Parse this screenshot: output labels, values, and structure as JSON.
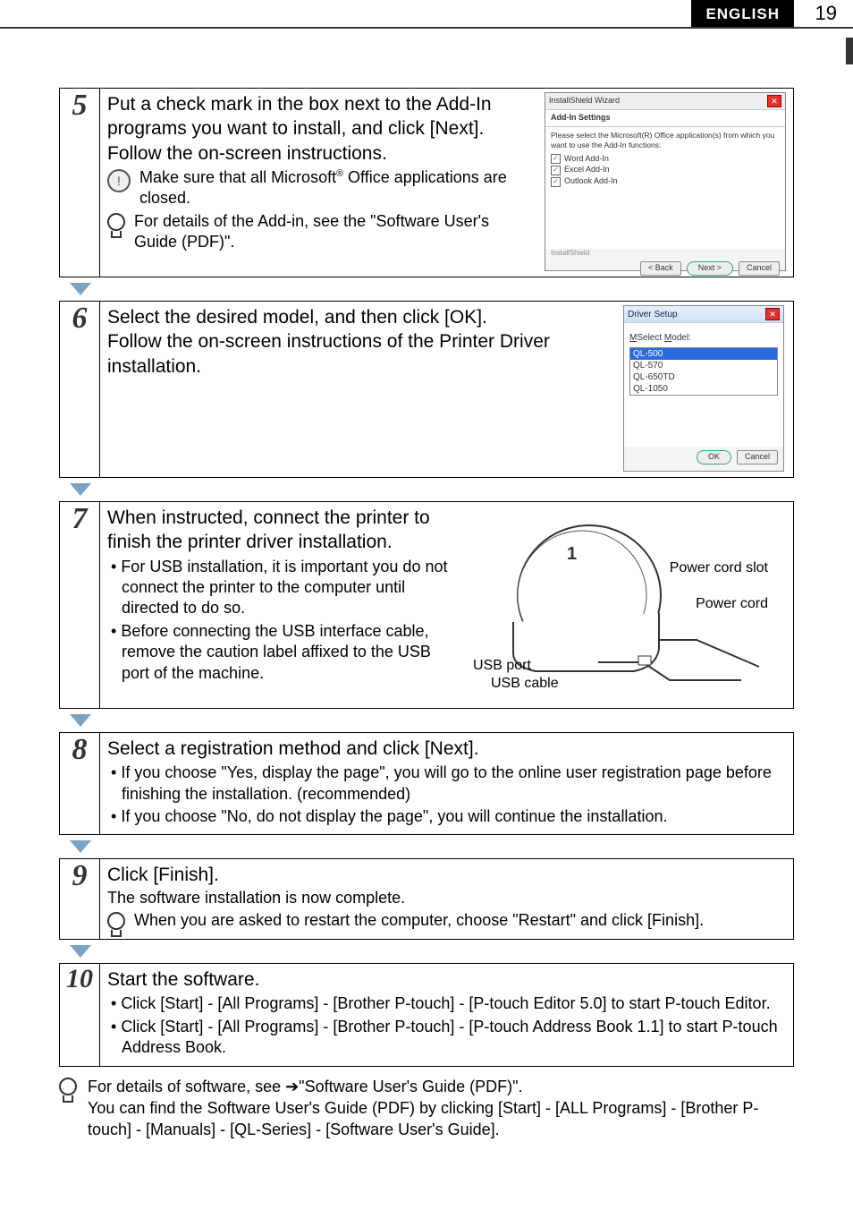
{
  "header": {
    "lang": "ENGLISH",
    "page": "19"
  },
  "steps": {
    "s5": {
      "num": "5",
      "line1": "Put a check mark in the box next to the Add-In programs you want to install, and click [Next].",
      "line2": "Follow the on-screen instructions.",
      "note1": "Make sure that all Microsoft",
      "note1_suffix": " Office applications are closed.",
      "note2": "For details of the Add-in, see the \"Software User's Guide (PDF)\"."
    },
    "dlg5": {
      "title": "InstallShield Wizard",
      "subtitle": "Add-In Settings",
      "desc": "Please select the Microsoft(R) Office application(s) from which you want to use the Add-In functions:",
      "opt1": "Word Add-In",
      "opt2": "Excel Add-In",
      "opt3": "Outlook Add-In",
      "foot": "InstallShield",
      "back": "< Back",
      "next": "Next >",
      "cancel": "Cancel"
    },
    "s6": {
      "num": "6",
      "line1": "Select the desired model, and then click [OK].",
      "line2": "Follow the on-screen instructions of the Printer Driver installation."
    },
    "dlg6": {
      "title": "Driver Setup",
      "label": "Select Model:",
      "m1": "QL-500",
      "m2": "QL-570",
      "m3": "QL-650TD",
      "m4": "QL-1050",
      "ok": "OK",
      "cancel": "Cancel"
    },
    "s7": {
      "num": "7",
      "line1": "When instructed, connect the printer to finish the printer driver installation.",
      "b1": "For USB installation, it is important you do not connect the printer to the computer until directed to do so.",
      "b2": "Before connecting the USB interface cable, remove the caution label affixed to the USB port of the machine.",
      "lbl_slot": "Power cord slot",
      "lbl_cord": "Power cord",
      "lbl_port": "USB port",
      "lbl_cable": "USB cable"
    },
    "s8": {
      "num": "8",
      "line1": "Select a registration method and click [Next].",
      "b1": "If you choose \"Yes, display the page\", you will go to the online user registration page before finishing the installation. (recommended)",
      "b2": "If you choose \"No, do not display the page\", you will continue the installation."
    },
    "s9": {
      "num": "9",
      "line1": "Click [Finish].",
      "line2": "The software installation is now complete.",
      "note": "When you are asked to restart the computer, choose \"Restart\" and click [Finish]."
    },
    "s10": {
      "num": "10",
      "line1": "Start the software.",
      "b1": "Click [Start] - [All Programs] - [Brother P-touch] - [P-touch Editor 5.0] to start P-touch Editor.",
      "b2": "Click [Start] - [All Programs] - [Brother P-touch] - [P-touch Address Book 1.1] to start P-touch Address Book."
    }
  },
  "footer": {
    "l1": "For details of software, see ➔\"Software User's Guide (PDF)\".",
    "l2": "You can find the Software User's Guide (PDF) by clicking [Start] - [ALL Programs] - [Brother P-touch] - [Manuals] - [QL-Series] - [Software User's Guide]."
  }
}
